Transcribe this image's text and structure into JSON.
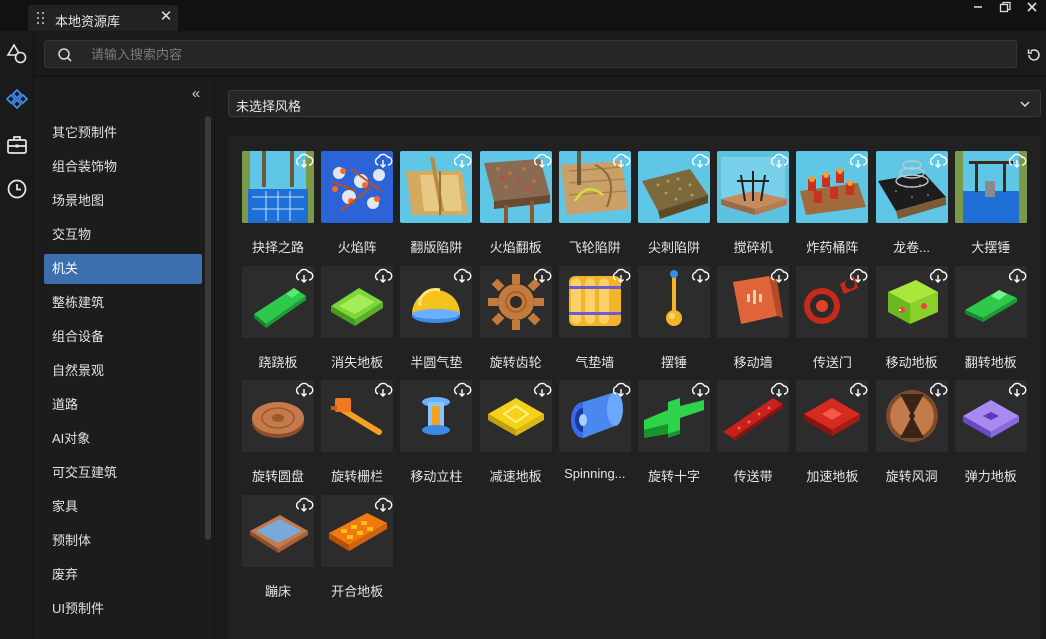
{
  "window": {
    "tab_title": "本地资源库"
  },
  "search": {
    "placeholder": "请输入搜索内容"
  },
  "sidebar": {
    "categories": [
      {
        "label": "其它预制件"
      },
      {
        "label": "组合装饰物"
      },
      {
        "label": "场景地图"
      },
      {
        "label": "交互物"
      },
      {
        "label": "机关",
        "active": true
      },
      {
        "label": "整栋建筑"
      },
      {
        "label": "组合设备"
      },
      {
        "label": "自然景观"
      },
      {
        "label": "道路"
      },
      {
        "label": "AI对象"
      },
      {
        "label": "可交互建筑"
      },
      {
        "label": "家具"
      },
      {
        "label": "预制体"
      },
      {
        "label": "废弃"
      },
      {
        "label": "UI预制件"
      }
    ]
  },
  "filter": {
    "style_value": "未选择风格"
  },
  "assets": [
    {
      "label": "抉择之路",
      "icon": "glass-bridge-scene"
    },
    {
      "label": "火焰阵",
      "icon": "flame-array-scene"
    },
    {
      "label": "翻版陷阱",
      "icon": "flip-trap-scene"
    },
    {
      "label": "火焰翻板",
      "icon": "flame-flip-scene"
    },
    {
      "label": "飞轮陷阱",
      "icon": "flywheel-trap-scene"
    },
    {
      "label": "尖刺陷阱",
      "icon": "spike-trap-scene"
    },
    {
      "label": "搅碎机",
      "icon": "shredder-scene"
    },
    {
      "label": "炸药桶阵",
      "icon": "barrel-array-scene"
    },
    {
      "label": "龙卷...",
      "icon": "tornado-scene"
    },
    {
      "label": "大摆锤",
      "icon": "pendulum-scene"
    },
    {
      "label": "跷跷板",
      "icon": "seesaw-model"
    },
    {
      "label": "消失地板",
      "icon": "vanishing-floor-model"
    },
    {
      "label": "半圆气垫",
      "icon": "dome-cushion-model"
    },
    {
      "label": "旋转齿轮",
      "icon": "gear-model"
    },
    {
      "label": "气垫墙",
      "icon": "cushion-wall-model"
    },
    {
      "label": "摆锤",
      "icon": "pendulum-model"
    },
    {
      "label": "移动墙",
      "icon": "moving-wall-model"
    },
    {
      "label": "传送门",
      "icon": "portal-model"
    },
    {
      "label": "移动地板",
      "icon": "moving-floor-model"
    },
    {
      "label": "翻转地板",
      "icon": "flip-floor-model"
    },
    {
      "label": "旋转圆盘",
      "icon": "disc-model"
    },
    {
      "label": "旋转栅栏",
      "icon": "rotating-bar-model"
    },
    {
      "label": "移动立柱",
      "icon": "pillar-model"
    },
    {
      "label": "减速地板",
      "icon": "slow-floor-model"
    },
    {
      "label": "Spinning...",
      "icon": "spinning-drum-model"
    },
    {
      "label": "旋转十字",
      "icon": "cross-model"
    },
    {
      "label": "传送带",
      "icon": "conveyor-model"
    },
    {
      "label": "加速地板",
      "icon": "boost-floor-model"
    },
    {
      "label": "旋转风洞",
      "icon": "wind-tunnel-model"
    },
    {
      "label": "弹力地板",
      "icon": "bounce-floor-model"
    },
    {
      "label": "蹦床",
      "icon": "trampoline-model"
    },
    {
      "label": "开合地板",
      "icon": "split-floor-model"
    }
  ],
  "colors": {
    "accent": "#3c6fb0",
    "background": "#1b1b1b",
    "panel": "#212121"
  }
}
